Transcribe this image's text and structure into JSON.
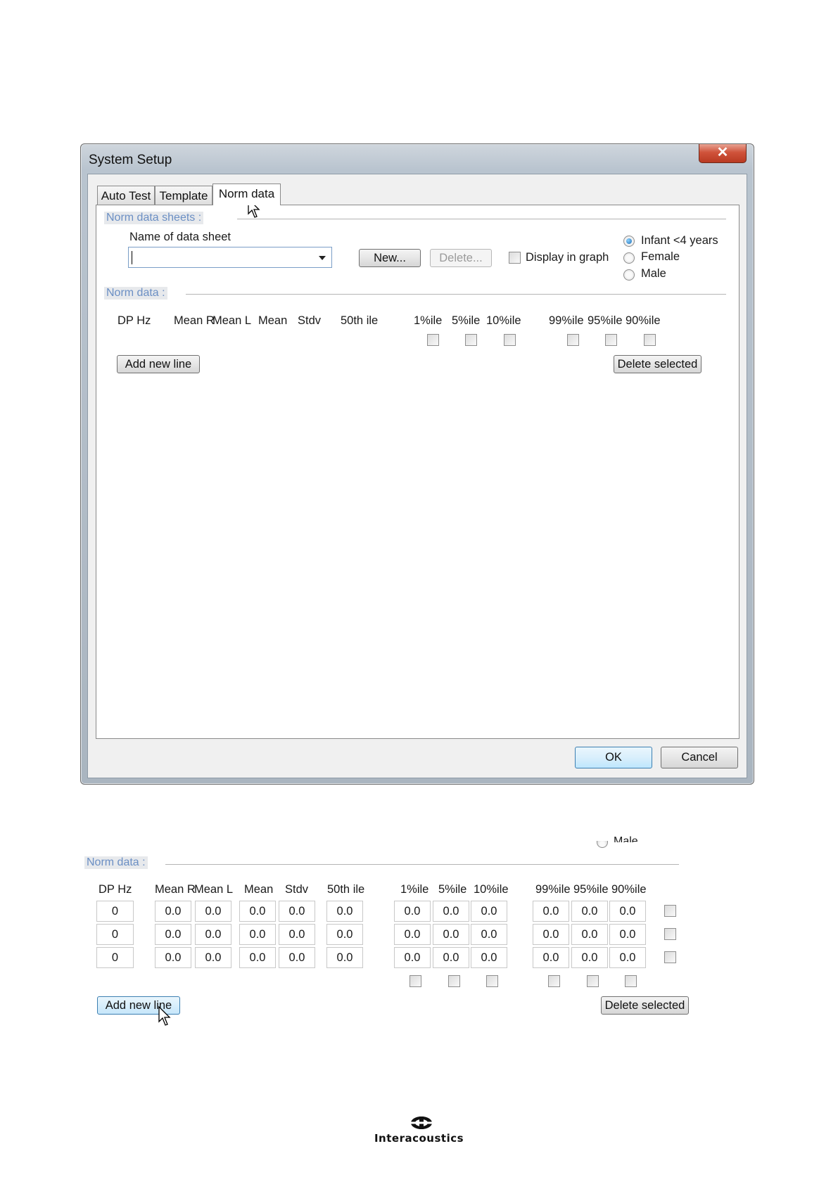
{
  "window": {
    "title": "System Setup",
    "close_glyph": "✕",
    "tabs": [
      "Auto Test",
      "Template",
      "Norm data"
    ],
    "active_tab": "Norm data"
  },
  "norm_data_sheets": {
    "group_label": "Norm data sheets :",
    "name_label": "Name of data sheet",
    "name_value": "",
    "new_button": "New...",
    "delete_button": "Delete...",
    "display_in_graph_label": "Display in graph",
    "radio_options": [
      "Infant <4 years",
      "Female",
      "Male"
    ],
    "radio_selected": "Infant <4 years"
  },
  "norm_data": {
    "group_label": "Norm data :",
    "columns": [
      "DP Hz",
      "Mean R",
      "Mean L",
      "Mean",
      "Stdv",
      "50th ile",
      "1%ile",
      "5%ile",
      "10%ile",
      "99%ile",
      "95%ile",
      "90%ile"
    ],
    "add_button": "Add new line",
    "delete_selected_button": "Delete selected"
  },
  "footer": {
    "ok_button": "OK",
    "cancel_button": "Cancel"
  },
  "norm_data_filled": {
    "partial_radio_label": "Male",
    "group_label": "Norm data :",
    "columns": [
      "DP Hz",
      "Mean R",
      "Mean L",
      "Mean",
      "Stdv",
      "50th ile",
      "1%ile",
      "5%ile",
      "10%ile",
      "99%ile",
      "95%ile",
      "90%ile"
    ],
    "rows": [
      [
        "0",
        "0.0",
        "0.0",
        "0.0",
        "0.0",
        "0.0",
        "0.0",
        "0.0",
        "0.0",
        "0.0",
        "0.0",
        "0.0"
      ],
      [
        "0",
        "0.0",
        "0.0",
        "0.0",
        "0.0",
        "0.0",
        "0.0",
        "0.0",
        "0.0",
        "0.0",
        "0.0",
        "0.0"
      ],
      [
        "0",
        "0.0",
        "0.0",
        "0.0",
        "0.0",
        "0.0",
        "0.0",
        "0.0",
        "0.0",
        "0.0",
        "0.0",
        "0.0"
      ]
    ],
    "add_button": "Add new line",
    "delete_selected_button": "Delete selected"
  },
  "logo": {
    "text": "Interacoustics",
    "icon": "interacoustics-logo-icon"
  }
}
